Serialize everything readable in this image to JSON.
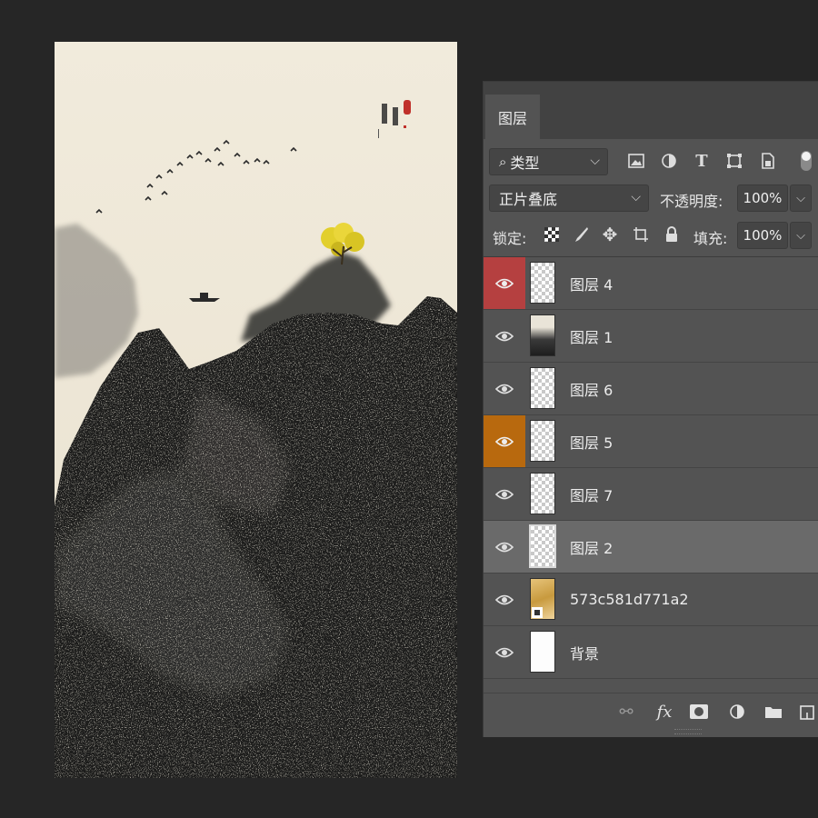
{
  "panel": {
    "tab_label": "图层",
    "filter": {
      "value": "类型"
    },
    "blend_mode": {
      "value": "正片叠底"
    },
    "opacity": {
      "label": "不透明度:",
      "value": "100%"
    },
    "lock": {
      "label": "锁定:"
    },
    "fill": {
      "label": "填充:",
      "value": "100%"
    },
    "layers": [
      {
        "name": "图层 4",
        "eye_color": "#b54040",
        "thumb": "transparent"
      },
      {
        "name": "图层 1",
        "thumb": "ink"
      },
      {
        "name": "图层 6",
        "thumb": "transparent"
      },
      {
        "name": "图层 5",
        "eye_color": "#b8690e",
        "thumb": "transparent"
      },
      {
        "name": "图层 7",
        "thumb": "transparent"
      },
      {
        "name": "图层 2",
        "thumb": "transparent",
        "selected": true
      },
      {
        "name": "573c581d771a2",
        "thumb": "gold"
      },
      {
        "name": "背景",
        "thumb": "white"
      }
    ],
    "icons": {
      "filter": [
        "image-filter-icon",
        "adjustment-filter-icon",
        "type-filter-icon",
        "shape-filter-icon",
        "smart-object-filter-icon",
        "filter-toggle-icon"
      ],
      "lock": [
        "lock-transparent-pixels-icon",
        "lock-image-pixels-icon",
        "lock-position-icon",
        "prevent-autonest-icon",
        "lock-all-icon"
      ],
      "footer": [
        "link-layers-icon",
        "fx-icon",
        "add-mask-icon",
        "adjustment-layer-icon",
        "new-group-icon",
        "new-layer-icon"
      ]
    },
    "footer_fx": "fx"
  },
  "colors": {
    "app_background": "#262626",
    "panel_background": "#535353",
    "selected_layer": "#6a6a6a",
    "paper": "#efe8d8",
    "ink": "#1c1c1c",
    "tree_yellow": "#e7d230"
  }
}
